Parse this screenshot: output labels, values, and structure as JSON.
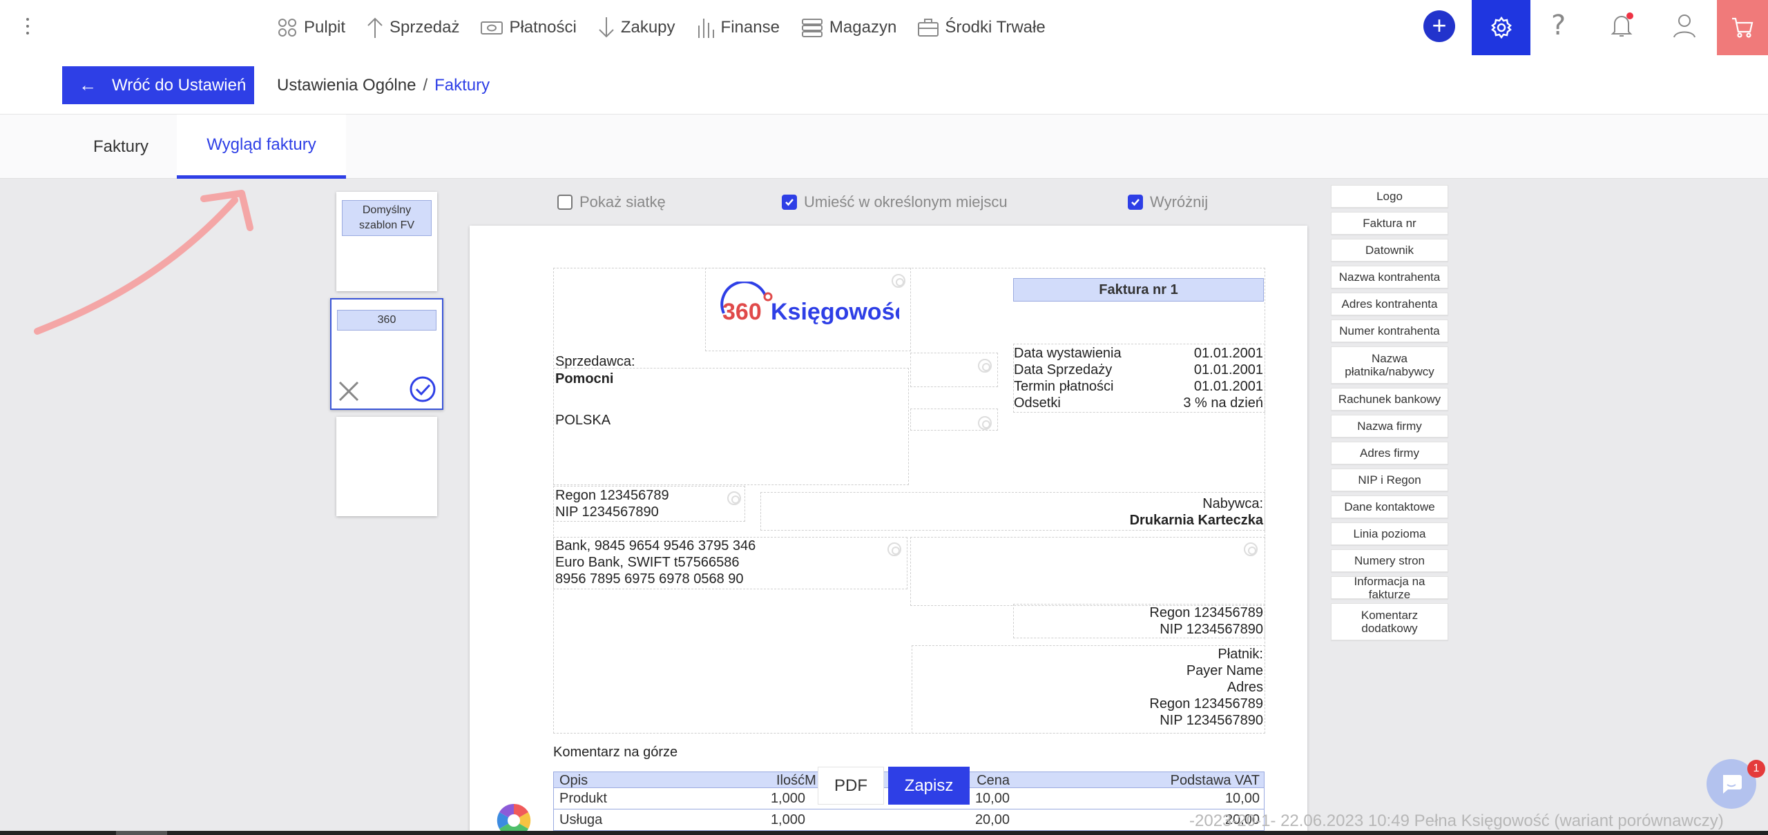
{
  "nav": {
    "items": [
      {
        "label": "Pulpit",
        "icon": "dashboard-icon"
      },
      {
        "label": "Sprzedaż",
        "icon": "arrow-up-icon"
      },
      {
        "label": "Płatności",
        "icon": "money-icon"
      },
      {
        "label": "Zakupy",
        "icon": "arrow-down-icon"
      },
      {
        "label": "Finanse",
        "icon": "bar-chart-icon"
      },
      {
        "label": "Magazyn",
        "icon": "warehouse-icon"
      },
      {
        "label": "Środki Trwałe",
        "icon": "briefcase-icon"
      }
    ],
    "add": "+"
  },
  "crumb": {
    "back_label": "Wróć do Ustawień",
    "parent": "Ustawienia Ogólne",
    "separator": "/",
    "current": "Faktury"
  },
  "tabs": [
    {
      "label": "Faktury"
    },
    {
      "label": "Wygląd faktury"
    }
  ],
  "templates": [
    {
      "label": "Domyślny szablon FV"
    },
    {
      "label": "360"
    }
  ],
  "options": {
    "grid": {
      "label": "Pokaż siatkę",
      "checked": false
    },
    "place": {
      "label": "Umieść w określonym miejscu",
      "checked": true
    },
    "highlight": {
      "label": "Wyróżnij",
      "checked": true
    }
  },
  "invoice": {
    "title": "Faktura nr 1",
    "logo_number": "360",
    "logo_word": "Księgowość",
    "seller_label": "Sprzedawca:",
    "seller_name": "Pomocni",
    "seller_country": "POLSKA",
    "seller_regon": "Regon 123456789",
    "seller_nip": "NIP 1234567890",
    "bank1": "Bank, 9845 9654 9546 3795 346",
    "bank2": "Euro Bank,  SWIFT t57566586",
    "bank3": "8956 7895 6975 6978 0568 90",
    "dates": [
      {
        "label": "Data wystawienia",
        "value": "01.01.2001"
      },
      {
        "label": "Data Sprzedaży",
        "value": "01.01.2001"
      },
      {
        "label": "Termin płatności",
        "value": "01.01.2001"
      },
      {
        "label": "Odsetki",
        "value": "3 % na dzień"
      }
    ],
    "buyer_label": "Nabywca:",
    "buyer_name": "Drukarnia Karteczka",
    "buyer_regon": "Regon 123456789",
    "buyer_nip": "NIP 1234567890",
    "payer_label": "Płatnik:",
    "payer_name": "Payer Name",
    "payer_address": "Adres",
    "payer_regon": "Regon 123456789",
    "payer_nip": "NIP 1234567890",
    "comment_top": "Komentarz na górze",
    "table": {
      "headers": {
        "desc": "Opis",
        "qty": "IlośćM",
        "price": "Cena",
        "vat_base": "Podstawa VAT"
      },
      "rows": [
        {
          "desc": "Produkt",
          "qty": "1,000",
          "price": "10,00",
          "vat_base": "10,00"
        },
        {
          "desc": "Usługa",
          "qty": "1,000",
          "price": "20,00",
          "vat_base": "20,00"
        }
      ]
    }
  },
  "actions": {
    "pdf": "PDF",
    "save": "Zapisz"
  },
  "palette": [
    "Logo",
    "Faktura nr",
    "Datownik",
    "Nazwa kontrahenta",
    "Adres kontrahenta",
    "Numer kontrahenta",
    "Nazwa płatnika/nabywcy",
    "Rachunek bankowy",
    "Nazwa firmy",
    "Adres firmy",
    "NIP i Regon",
    "Dane kontaktowe",
    "Linia pozioma",
    "Numery stron",
    "Informacja na fakturze",
    "Komentarz dodatkowy"
  ],
  "footer": {
    "text": "-2023-20-1- 22.06.2023 10:49 Pełna Księgowość (wariant porównawczy)",
    "chat_badge": "1"
  },
  "colors": {
    "accent": "#2e3fe6",
    "cart": "#f07a7a",
    "highlight": "#d2dcfa",
    "logo_red": "#e04a4a"
  }
}
